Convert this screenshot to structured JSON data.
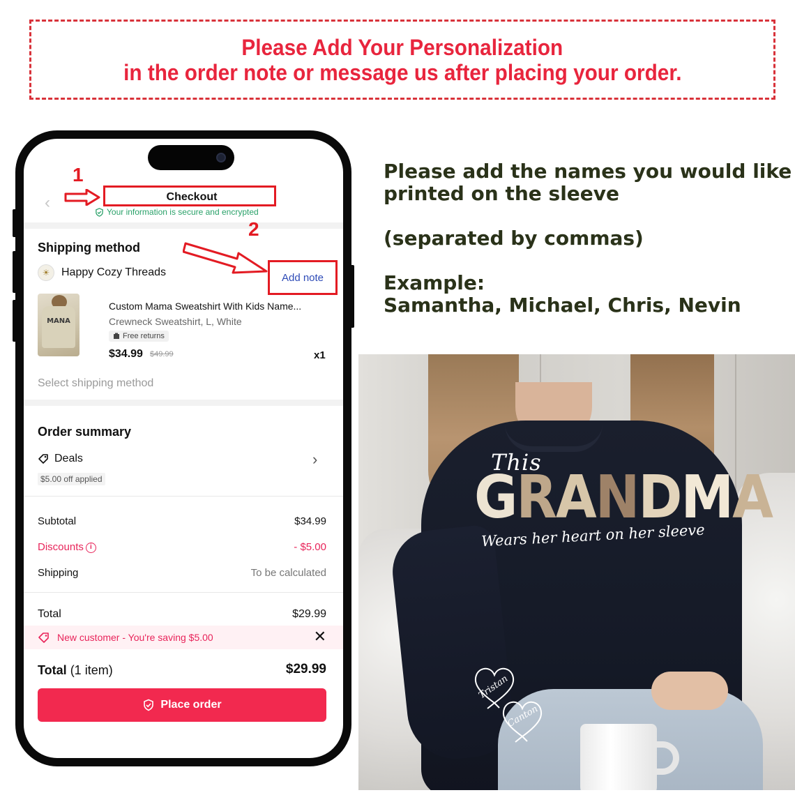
{
  "banner": {
    "line1": "Please Add Your Personalization",
    "line2": "in the order note or message us after placing your order.",
    "color": "#e8253d"
  },
  "phone": {
    "steps": [
      "1",
      "2"
    ],
    "header": {
      "title": "Checkout",
      "secure_text": "Your information is secure and encrypted",
      "back_icon": "chevron-left-icon"
    },
    "shipping": {
      "section_title": "Shipping method",
      "shop_name": "Happy Cozy Threads",
      "add_note_label": "Add note",
      "product": {
        "title": "Custom Mama Sweatshirt With Kids Name...",
        "variant": "Crewneck Sweatshirt, L, White",
        "badge": "Free returns",
        "price": "$34.99",
        "original_price": "$49.99",
        "quantity": "x1",
        "thumb_text": "MANA"
      },
      "select_method": "Select shipping method"
    },
    "summary": {
      "section_title": "Order summary",
      "deals_label": "Deals",
      "deals_badge": "$5.00 off applied",
      "rows": [
        {
          "label": "Subtotal",
          "value": "$34.99"
        },
        {
          "label": "Discounts",
          "value": "- $5.00"
        },
        {
          "label": "Shipping",
          "value": "To be calculated"
        },
        {
          "label": "Total",
          "value": "$29.99"
        }
      ]
    },
    "promo": {
      "text": "New customer - You're saving $5.00"
    },
    "footer": {
      "total_label": "Total",
      "total_items": "(1 item)",
      "total_value": "$29.99",
      "place_order_label": "Place order"
    },
    "accent": "#f2294f"
  },
  "instructions": {
    "line1": "Please add the names you would like",
    "line2": "printed on the sleeve",
    "line3": "(separated by commas)",
    "line4": "Example:",
    "line5": "Samantha, Michael, Chris, Nevin",
    "color": "#2a3219"
  },
  "photo": {
    "print_this": "This",
    "print_grandma": [
      "G",
      "R",
      "A",
      "N",
      "D",
      "M",
      "A"
    ],
    "print_sub": "Wears her heart on her sleeve",
    "sleeve_names": [
      "Tristan",
      "Canton"
    ]
  }
}
